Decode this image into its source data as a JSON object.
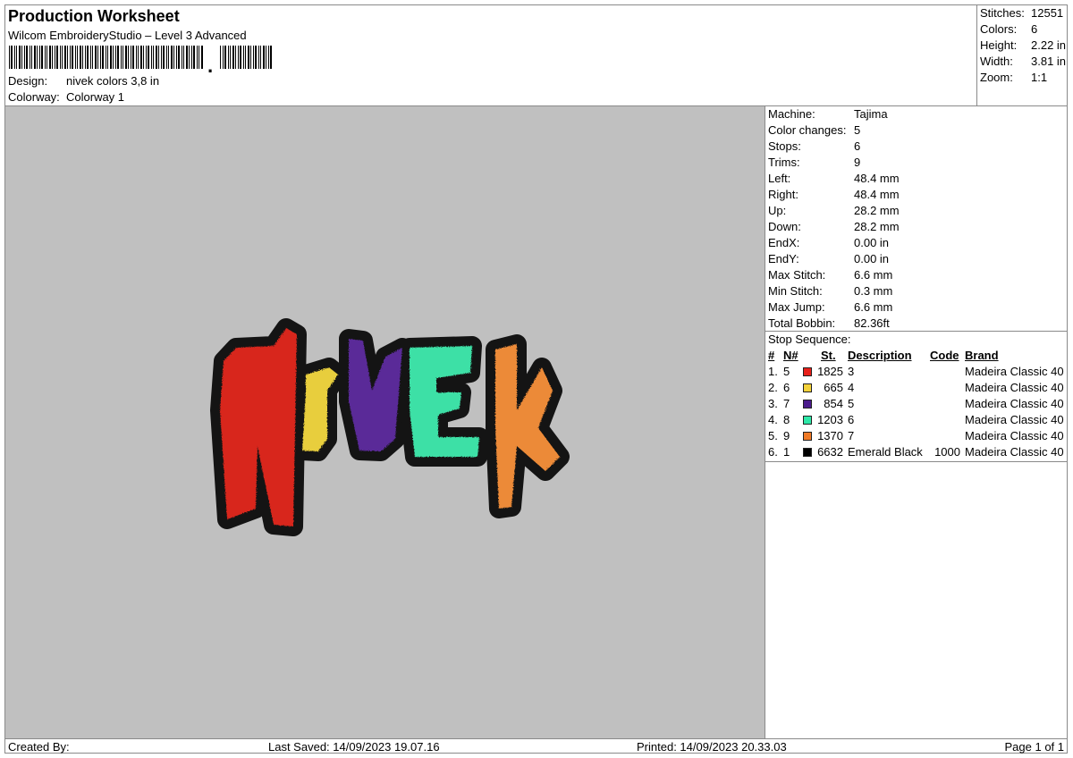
{
  "header": {
    "title": "Production Worksheet",
    "subtitle": "Wilcom EmbroideryStudio – Level 3 Advanced",
    "design_label": "Design:",
    "design_value": "nivek colors 3,8 in",
    "colorway_label": "Colorway:",
    "colorway_value": "Colorway 1"
  },
  "summary": [
    {
      "label": "Stitches:",
      "value": "12551"
    },
    {
      "label": "Colors:",
      "value": "6"
    },
    {
      "label": "Height:",
      "value": "2.22 in"
    },
    {
      "label": "Width:",
      "value": "3.81 in"
    },
    {
      "label": "Zoom:",
      "value": "1:1"
    }
  ],
  "machine_info": [
    {
      "label": "Machine:",
      "value": "Tajima"
    },
    {
      "label": "Color changes:",
      "value": "5"
    },
    {
      "label": "Stops:",
      "value": "6"
    },
    {
      "label": "Trims:",
      "value": "9"
    },
    {
      "label": "Left:",
      "value": "48.4 mm"
    },
    {
      "label": "Right:",
      "value": "48.4 mm"
    },
    {
      "label": "Up:",
      "value": "28.2 mm"
    },
    {
      "label": "Down:",
      "value": "28.2 mm"
    },
    {
      "label": "EndX:",
      "value": "0.00 in"
    },
    {
      "label": "EndY:",
      "value": "0.00 in"
    },
    {
      "label": "Max Stitch:",
      "value": "6.6 mm"
    },
    {
      "label": "Min Stitch:",
      "value": "0.3 mm"
    },
    {
      "label": "Max Jump:",
      "value": "6.6 mm"
    },
    {
      "label": "Total Bobbin:",
      "value": "82.36ft"
    }
  ],
  "stop_sequence": {
    "label": "Stop Sequence:",
    "headers": {
      "num": "#",
      "n": "N#",
      "st": "St.",
      "description": "Description",
      "code": "Code",
      "brand": "Brand"
    },
    "rows": [
      {
        "num": "1.",
        "n": "5",
        "color": "#e8201a",
        "st": "1825",
        "description": "3",
        "code": "",
        "brand": "Madeira Classic 40"
      },
      {
        "num": "2.",
        "n": "6",
        "color": "#f4d23a",
        "st": "665",
        "description": "4",
        "code": "",
        "brand": "Madeira Classic 40"
      },
      {
        "num": "3.",
        "n": "7",
        "color": "#4b1b8c",
        "st": "854",
        "description": "5",
        "code": "",
        "brand": "Madeira Classic 40"
      },
      {
        "num": "4.",
        "n": "8",
        "color": "#2ee8a8",
        "st": "1203",
        "description": "6",
        "code": "",
        "brand": "Madeira Classic 40"
      },
      {
        "num": "5.",
        "n": "9",
        "color": "#f07a26",
        "st": "1370",
        "description": "7",
        "code": "",
        "brand": "Madeira Classic 40"
      },
      {
        "num": "6.",
        "n": "1",
        "color": "#000000",
        "st": "6632",
        "description": "Emerald Black",
        "code": "1000",
        "brand": "Madeira Classic 40"
      }
    ]
  },
  "design_preview": {
    "letters": [
      {
        "char": "N",
        "color": "#d8261c"
      },
      {
        "char": "I",
        "color": "#e8ce3c"
      },
      {
        "char": "V",
        "color": "#5a2a98"
      },
      {
        "char": "E",
        "color": "#3ee0a6"
      },
      {
        "char": "K",
        "color": "#ec8a38"
      }
    ],
    "outline_color": "#141414"
  },
  "footer": {
    "created_by": "Created By:",
    "last_saved": "Last Saved: 14/09/2023 19.07.16",
    "printed": "Printed: 14/09/2023 20.33.03",
    "page": "Page 1 of 1"
  }
}
